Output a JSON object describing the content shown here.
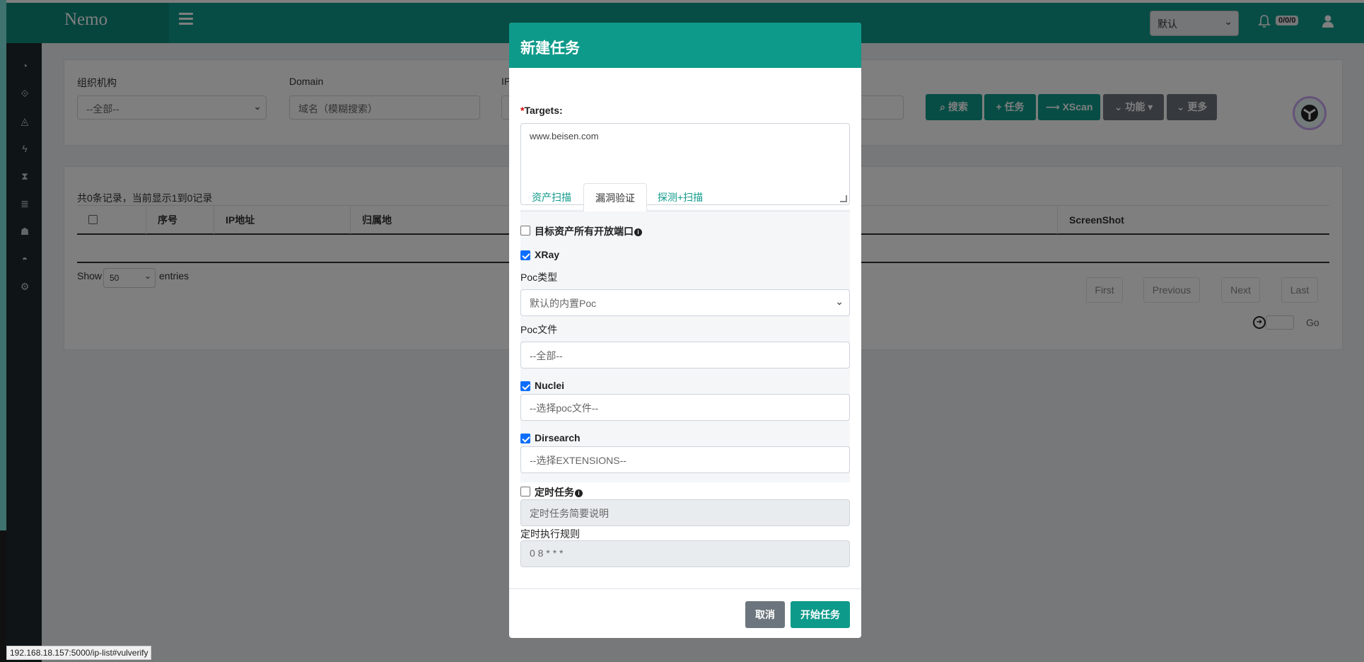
{
  "app": {
    "brand": "Nemo",
    "group_selected": "默认",
    "notifications": "0/0/0"
  },
  "filters": {
    "org_label": "组织机构",
    "org_value": "--全部--",
    "domain_label": "Domain",
    "domain_placeholder": "域名（模糊搜索）",
    "ip_label": "IP"
  },
  "toolbar": {
    "search": "搜索",
    "task": "任务",
    "xscan": "XScan",
    "function": "功能",
    "more": "更多"
  },
  "table": {
    "records_summary": "共0条记录，当前显示1到0记录",
    "columns": [
      "序号",
      "IP地址",
      "归属地",
      "ScreenShot"
    ]
  },
  "pagination": {
    "show": "Show",
    "entries_value": "50",
    "entries": "entries",
    "first": "First",
    "previous": "Previous",
    "next": "Next",
    "last": "Last",
    "go": "Go"
  },
  "modal": {
    "title": "新建任务",
    "targets_required": "*",
    "targets_label": "Targets:",
    "targets_value": "www.beisen.com",
    "tabs": [
      "资产扫描",
      "漏洞验证",
      "探测+扫描"
    ],
    "all_ports_label": "目标资产所有开放端口",
    "xray_label": "XRay",
    "poc_type_label": "Poc类型",
    "poc_type_value": "默认的内置Poc",
    "poc_file_label": "Poc文件",
    "poc_file_placeholder": "--全部--",
    "nuclei_label": "Nuclei",
    "nuclei_placeholder": "--选择poc文件--",
    "dirsearch_label": "Dirsearch",
    "dirsearch_placeholder": "--选择EXTENSIONS--",
    "cron_label": "定时任务",
    "cron_desc_placeholder": "定时任务简要说明",
    "cron_rule_label": "定时执行规则",
    "cron_rule_value": "0 8 * * *",
    "cancel": "取消",
    "start": "开始任务"
  },
  "status_url": "192.168.18.157:5000/ip-list#vulverify"
}
